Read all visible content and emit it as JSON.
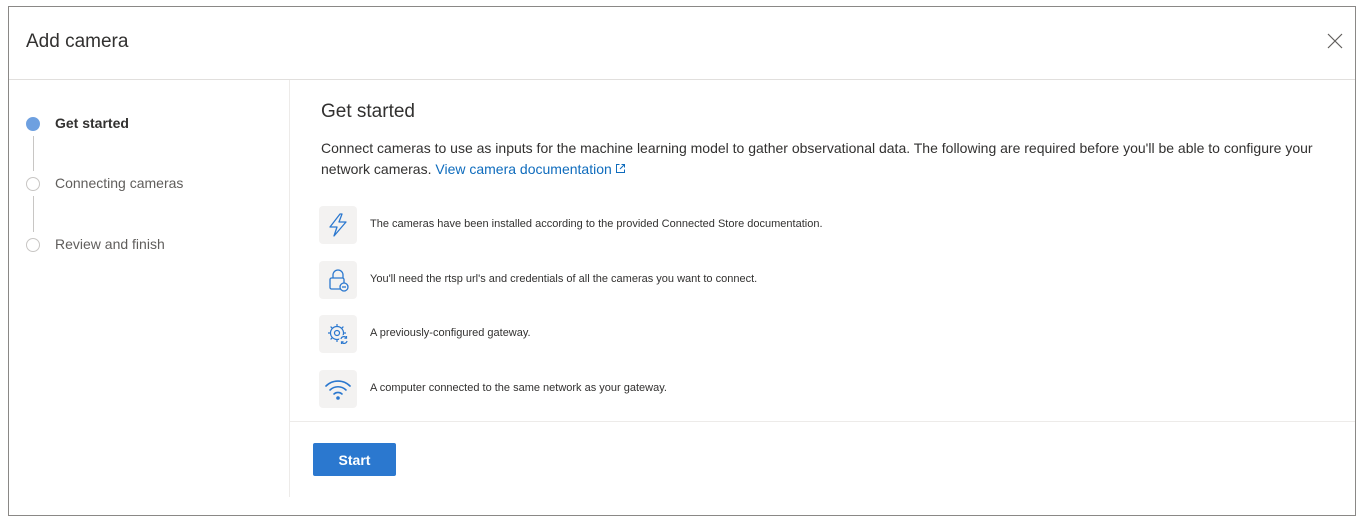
{
  "dialog": {
    "title": "Add camera",
    "close_label": "Close"
  },
  "steps": [
    {
      "label": "Get started",
      "state": "current"
    },
    {
      "label": "Connecting cameras",
      "state": "pending"
    },
    {
      "label": "Review and finish",
      "state": "pending"
    }
  ],
  "main": {
    "title": "Get started",
    "intro_text": "Connect cameras to use as inputs for the machine learning model to gather observational data. The following are required before you'll be able to configure your network cameras.",
    "doc_link_label": "View camera documentation",
    "requirements": [
      {
        "icon": "lightning-icon",
        "text": "The cameras have been installed according to the provided Connected Store documentation."
      },
      {
        "icon": "lock-icon",
        "text": "You'll need the rtsp url's and credentials of all the cameras you want to connect."
      },
      {
        "icon": "gear-sync-icon",
        "text": "A previously-configured gateway."
      },
      {
        "icon": "wifi-icon",
        "text": "A computer connected to the same network as your gateway."
      }
    ],
    "start_label": "Start"
  },
  "colors": {
    "accent": "#2b78cf",
    "link": "#0f6cbd",
    "active_step": "#6ea0e0",
    "icon_tile_bg": "#f3f2f1"
  }
}
